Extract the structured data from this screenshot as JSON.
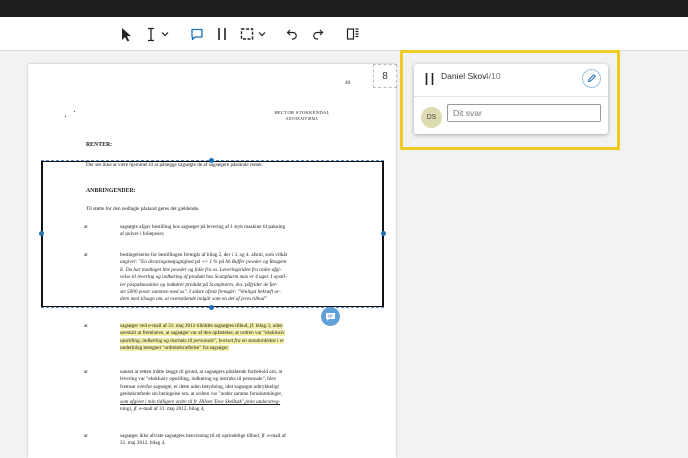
{
  "toolbar": {
    "tools": [
      "select-tool",
      "text-cursor-tool",
      "text-tool-dropdown",
      "comment-tool",
      "pipe-tool",
      "area-select-tool",
      "area-select-dropdown",
      "undo",
      "redo",
      "page-layout"
    ]
  },
  "page": {
    "page_number_box": "8",
    "header_number": "40",
    "letterhead_line1": "HECTOR STOKKENDAL",
    "letterhead_line2": "ADVOKATFIRMA",
    "renter_heading": "RENTER:",
    "renter_text": "Der ses ikke at være hjemmel til at pålægge sagsøgte de af sagsøgere påstände renter.",
    "anbringender_heading": "ANBRINGENDER:",
    "intro": "Til støtte for den nedlagte påstand gøres det gældende,",
    "items": [
      {
        "marker": "at",
        "lines": [
          "sagsøgte afgav bestilling hos sagsøger på levering af 1 styk maskine til pakning",
          "af pulver i folieposer,"
        ]
      },
      {
        "marker": "at",
        "lines": [
          "bestingelserne for bestillingen fremgår af bilag 2, der i 3. og 4. afsnit, som vilkår",
          "angiver: \"En divaringsmøjagtighed på +/- 1 % på hh Buffer powder og Reagent",
          "E. Du har modtaget hhv powder og folie fra os. Leveringstiden fra ordre afgi-",
          "velse til levering og indkøring af produkt hos Scanpharm max er 4 uger. I opstil-",
          "ler pospakmaskine og indkører produkt på Scanpharm, dvs. påfylder de før-",
          "ste 5000 poser sammen med os\". I sidste afsnit fremgår: \"Venligst bekræft or-",
          "dren med tilsagn om, at ovenstående indgår som en del af jeres tilbud\""
        ]
      },
      {
        "marker": "at",
        "lines": [
          "sagsøger ved e-mail af 31. maj 2012 tiltrådte sagsøgtes tilbud, jf. bilag 3, uden",
          "særskilt at fremhæve, at sagsøger var af den opfattelse, at ordren var \"eksklusiv",
          "opstilling, indkøring og instruks til personale\", bortset fra en standardtekst i et",
          "underbilag betegnet \"ordrebekræftelse\" fra sagsøger."
        ]
      },
      {
        "marker": "at",
        "lines": [
          "uanset at retten måtte lægge til grund, at sagsøgers påstående forbehold om, at",
          "levering var \"eksklusiv opstilling, indkøring og instruks til personale\", blev",
          "fremsat overfor sagsøgte, er dette uden betydning, idet sagsøgte udtrykkeligt",
          "genbekræftede sin betingelse om, at ordren var \"under samme forudsætninger,",
          "som afgivet i min tidligere ordre til fr. Hilsen Tove Skelbæk\",(min understreg-",
          "ning), jf. e-mail af 31. maj 2012, bilag 4,"
        ]
      },
      {
        "marker": "at",
        "lines": [
          "sagsøger ikke afviste sagsøgtes henvisning til sit oprindelige tilbud, jf. e-mail af",
          "31. maj 2012, bilag 4,"
        ]
      }
    ]
  },
  "comment": {
    "author": "Daniel Skov",
    "counter": "4/10",
    "avatar_initials": "DS",
    "reply_placeholder": "Dit svar",
    "reply_value": ""
  },
  "colors": {
    "highlight_frame": "#f0cc23",
    "text_highlight": "#f4efa6",
    "selection_handle": "#1f6fb8",
    "comment_bubble": "#5fa0d6"
  }
}
